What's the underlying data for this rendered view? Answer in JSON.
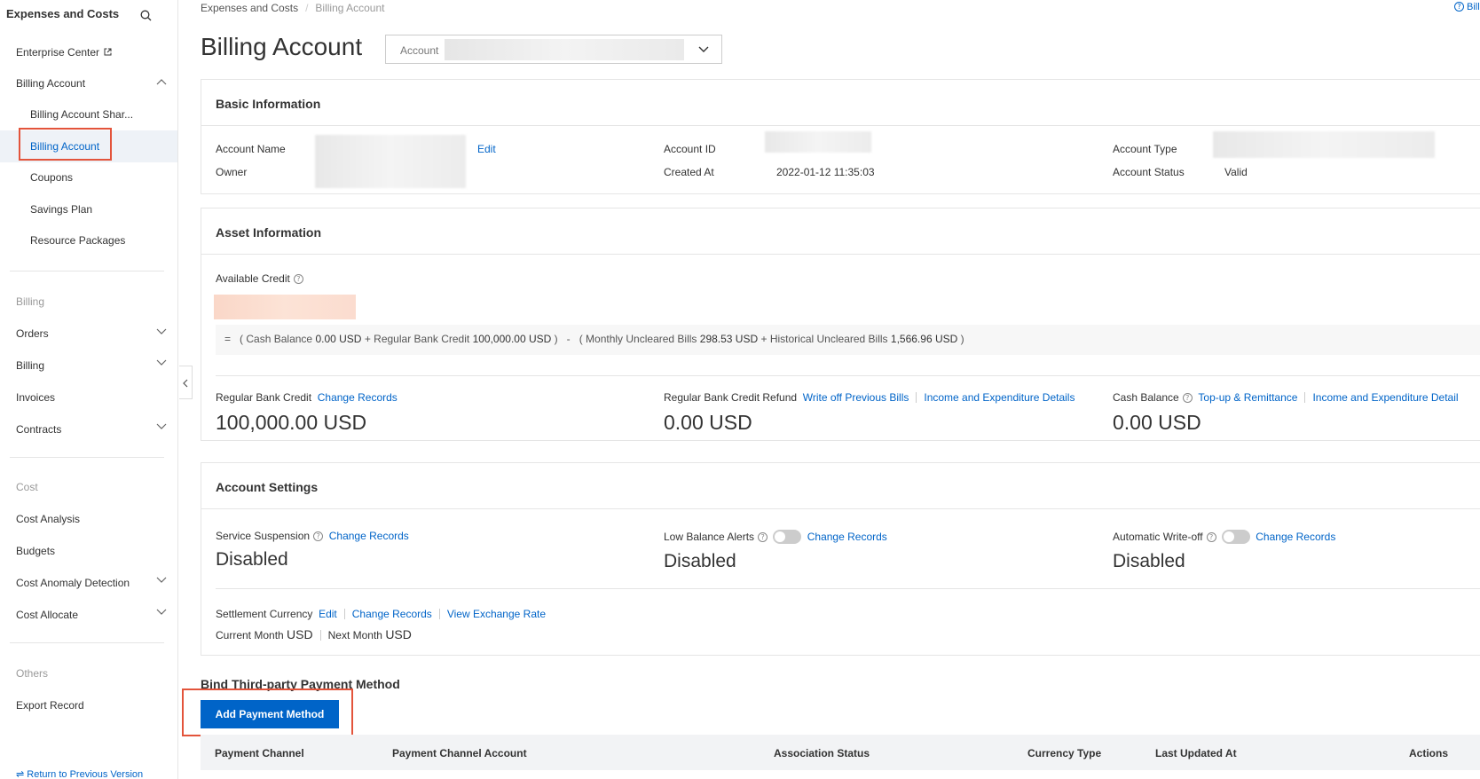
{
  "sidebar": {
    "title": "Expenses and Costs",
    "enterprise_center": "Enterprise Center",
    "billing_account": "Billing Account",
    "billing_account_sharing": "Billing Account Shar...",
    "billing_account_active": "Billing Account",
    "coupons": "Coupons",
    "savings_plan": "Savings Plan",
    "resource_packages": "Resource Packages",
    "group_billing": "Billing",
    "orders": "Orders",
    "billing": "Billing",
    "invoices": "Invoices",
    "contracts": "Contracts",
    "group_cost": "Cost",
    "cost_analysis": "Cost Analysis",
    "budgets": "Budgets",
    "cost_anomaly_detection": "Cost Anomaly Detection",
    "cost_allocate": "Cost Allocate",
    "group_others": "Others",
    "export_record": "Export Record",
    "footer": "Return to Previous Version"
  },
  "breadcrumb": {
    "root": "Expenses and Costs",
    "current": "Billing Account"
  },
  "help_link": "Bill",
  "page_title": "Billing Account",
  "account_select": {
    "label": "Account"
  },
  "basic_info": {
    "title": "Basic Information",
    "account_name_label": "Account Name",
    "edit": "Edit",
    "owner_label": "Owner",
    "account_id_label": "Account ID",
    "created_at_label": "Created At",
    "created_at_value": "2022-01-12 11:35:03",
    "account_type_label": "Account Type",
    "account_status_label": "Account Status",
    "account_status_value": "Valid"
  },
  "asset_info": {
    "title": "Asset Information",
    "available_credit_label": "Available Credit",
    "formula": {
      "eq": "=",
      "open1": "(",
      "cash_balance_label": "Cash Balance",
      "cash_balance_value": "0.00 USD",
      "plus1": "+",
      "regular_bank_credit_label": "Regular Bank Credit",
      "regular_bank_credit_value": "100,000.00 USD",
      "close1": ")",
      "minus": "-",
      "open2": "(",
      "monthly_uncleared_label": "Monthly Uncleared Bills",
      "monthly_uncleared_value": "298.53 USD",
      "plus2": "+",
      "historical_uncleared_label": "Historical Uncleared Bills",
      "historical_uncleared_value": "1,566.96 USD",
      "close2": ")"
    },
    "regular_bank_credit": {
      "label": "Regular Bank Credit",
      "link": "Change Records",
      "value": "100,000.00 USD"
    },
    "refund": {
      "label": "Regular Bank Credit Refund",
      "link1": "Write off Previous Bills",
      "link2": "Income and Expenditure Details",
      "value": "0.00 USD"
    },
    "cash_balance": {
      "label": "Cash Balance",
      "link1": "Top-up & Remittance",
      "link2": "Income and Expenditure Detail",
      "value": "0.00 USD"
    }
  },
  "account_settings": {
    "title": "Account Settings",
    "service_suspension": {
      "label": "Service Suspension",
      "link": "Change Records",
      "value": "Disabled"
    },
    "low_balance_alerts": {
      "label": "Low Balance Alerts",
      "link": "Change Records",
      "value": "Disabled"
    },
    "automatic_write_off": {
      "label": "Automatic Write-off",
      "link": "Change Records",
      "value": "Disabled"
    },
    "settlement_currency": {
      "label": "Settlement Currency",
      "edit": "Edit",
      "change_records": "Change Records",
      "exchange_rate": "View Exchange Rate",
      "current_month_label": "Current Month",
      "current_month_value": "USD",
      "next_month_label": "Next Month",
      "next_month_value": "USD"
    }
  },
  "payment": {
    "section_title": "Bind Third-party Payment Method",
    "add_button": "Add Payment Method",
    "columns": [
      "Payment Channel",
      "Payment Channel Account",
      "Association Status",
      "Currency Type",
      "Last Updated At",
      "Actions"
    ]
  },
  "colors": {
    "link": "#0064c8",
    "primary_button": "#0064c8",
    "highlight": "#e3543b",
    "credit_blur": "#fbdccf"
  },
  "icons": [
    "search-icon",
    "external-link-icon",
    "chevron-up-icon",
    "chevron-down-icon",
    "chevron-left-icon",
    "help-icon",
    "toggle-switch"
  ]
}
